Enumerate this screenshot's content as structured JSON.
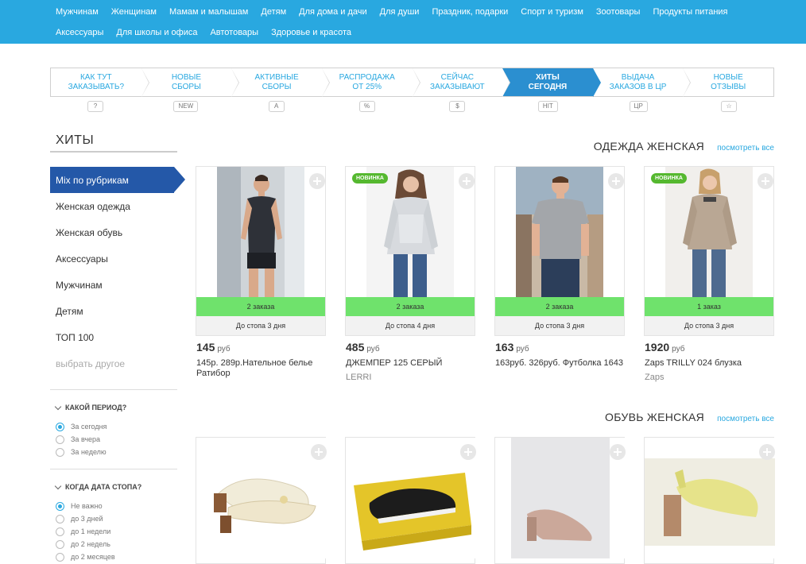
{
  "nav": {
    "row1": [
      "Мужчинам",
      "Женщинам",
      "Мамам и малышам",
      "Детям",
      "Для дома и дачи",
      "Для души",
      "Праздник, подарки",
      "Спорт и туризм",
      "Зоотовары",
      "Продукты питания"
    ],
    "row2": [
      "Аксессуары",
      "Для школы и офиса",
      "Автотовары",
      "Здоровье и красота"
    ]
  },
  "steps": [
    {
      "l1": "Как тут",
      "l2": "заказывать?",
      "badge": "?"
    },
    {
      "l1": "Новые",
      "l2": "сборы",
      "badge": "NEW"
    },
    {
      "l1": "Активные",
      "l2": "сборы",
      "badge": "A"
    },
    {
      "l1": "Распродажа",
      "l2": "от 25%",
      "badge": "%"
    },
    {
      "l1": "Сейчас",
      "l2": "заказывают",
      "badge": "$"
    },
    {
      "l1": "Хиты",
      "l2": "сегодня",
      "badge": "HIT"
    },
    {
      "l1": "Выдача",
      "l2": "заказов в ЦР",
      "badge": "ЦР"
    },
    {
      "l1": "Новые",
      "l2": "отзывы",
      "badge": "☆"
    }
  ],
  "sidebar": {
    "title": "ХИТЫ",
    "items": [
      "Mix по рубрикам",
      "Женская одежда",
      "Женская обувь",
      "Аксессуары",
      "Мужчинам",
      "Детям",
      "ТОП 100",
      "выбрать другое"
    ],
    "filter1": {
      "title": "Какой период?",
      "options": [
        "За сегодня",
        "За вчера",
        "За неделю"
      ]
    },
    "filter2": {
      "title": "Когда дата стопа?",
      "options": [
        "Не важно",
        "до 3 дней",
        "до 1 недели",
        "до 2 недель",
        "до 2 месяцев"
      ]
    }
  },
  "section1": {
    "title": "ОДЕЖДА ЖЕНСКАЯ",
    "link": "посмотреть все",
    "products": [
      {
        "orders": "2 заказа",
        "stop": "До стопа 3 дня",
        "price": "145",
        "cur": "руб",
        "name": "145р. 289р.Нательное белье Ратибор",
        "brand": "",
        "badge": ""
      },
      {
        "orders": "2 заказа",
        "stop": "До стопа 4 дня",
        "price": "485",
        "cur": "руб",
        "name": "ДЖЕМПЕР 125 СЕРЫЙ",
        "brand": "LERRI",
        "badge": "НОВИНКА"
      },
      {
        "orders": "2 заказа",
        "stop": "До стопа 3 дня",
        "price": "163",
        "cur": "руб",
        "name": "163руб. 326руб. Футболка 1643",
        "brand": "",
        "badge": ""
      },
      {
        "orders": "1 заказ",
        "stop": "До стопа 3 дня",
        "price": "1920",
        "cur": "руб",
        "name": "Zaps TRILLY 024 блузка",
        "brand": "Zaps",
        "badge": "НОВИНКА"
      }
    ]
  },
  "section2": {
    "title": "ОБУВЬ ЖЕНСКАЯ",
    "link": "посмотреть все"
  },
  "colors": {
    "nav": "#29a8e0",
    "active_step": "#2b8fd0",
    "active_side": "#2458a8",
    "orders_bar": "#6fe26c",
    "new_badge": "#55b82f"
  }
}
